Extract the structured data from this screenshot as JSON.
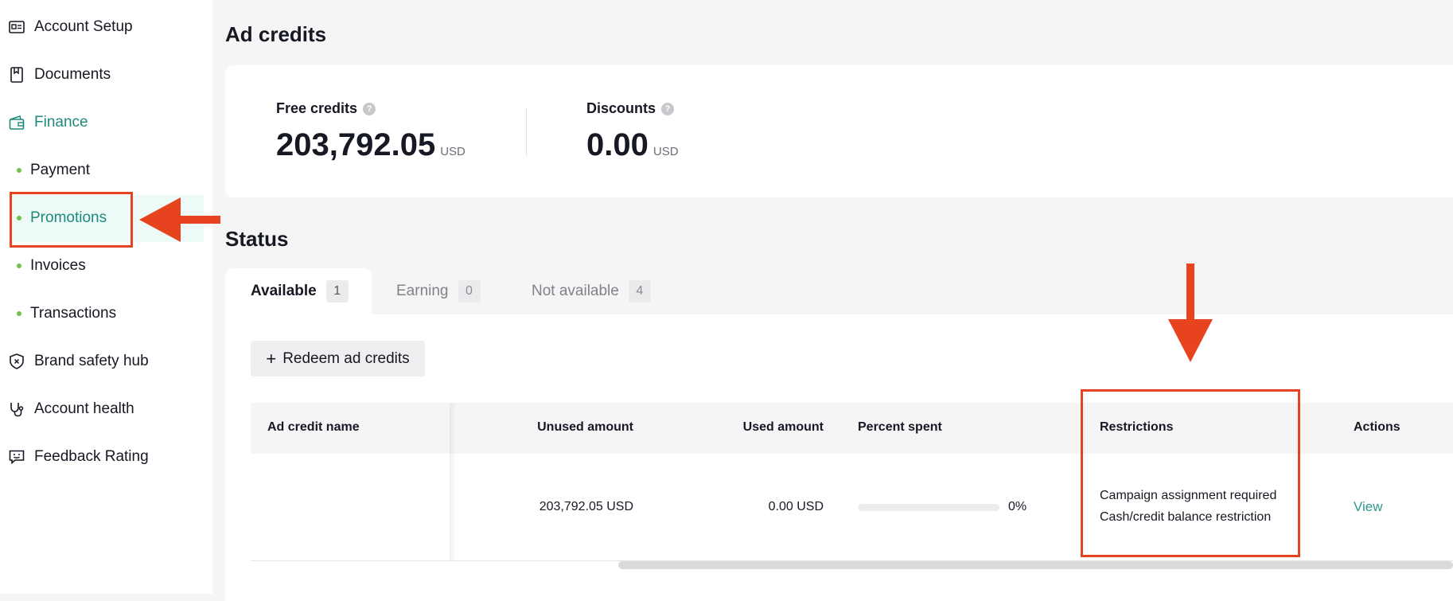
{
  "sidebar": {
    "items": [
      {
        "label": "Account Setup",
        "icon": "id-card-icon"
      },
      {
        "label": "Documents",
        "icon": "bookmark-doc-icon"
      },
      {
        "label": "Finance",
        "icon": "wallet-icon"
      },
      {
        "label": "Payment"
      },
      {
        "label": "Promotions"
      },
      {
        "label": "Invoices"
      },
      {
        "label": "Transactions"
      },
      {
        "label": "Brand safety hub",
        "icon": "shield-x-icon"
      },
      {
        "label": "Account health",
        "icon": "stethoscope-icon"
      },
      {
        "label": "Feedback Rating",
        "icon": "feedback-icon"
      }
    ]
  },
  "page": {
    "title": "Ad credits",
    "free_credits": {
      "label": "Free credits",
      "value": "203,792.05",
      "unit": "USD"
    },
    "discounts": {
      "label": "Discounts",
      "value": "0.00",
      "unit": "USD"
    },
    "status_title": "Status"
  },
  "tabs": [
    {
      "label": "Available",
      "count": "1"
    },
    {
      "label": "Earning",
      "count": "0"
    },
    {
      "label": "Not available",
      "count": "4"
    }
  ],
  "redeem_label": "Redeem ad credits",
  "table": {
    "headers": [
      "Ad credit name",
      "Unused amount",
      "Used amount",
      "Percent spent",
      "Restrictions",
      "Actions"
    ],
    "rows": [
      {
        "name": "",
        "unused": "203,792.05 USD",
        "used": "0.00 USD",
        "percent_spent": "0%",
        "percent_value": 0,
        "restrictions": [
          "Campaign assignment required",
          "Cash/credit balance restriction"
        ],
        "action": "View"
      }
    ]
  },
  "colors": {
    "accent": "#1e8a7a",
    "annotation": "#e8431f"
  }
}
